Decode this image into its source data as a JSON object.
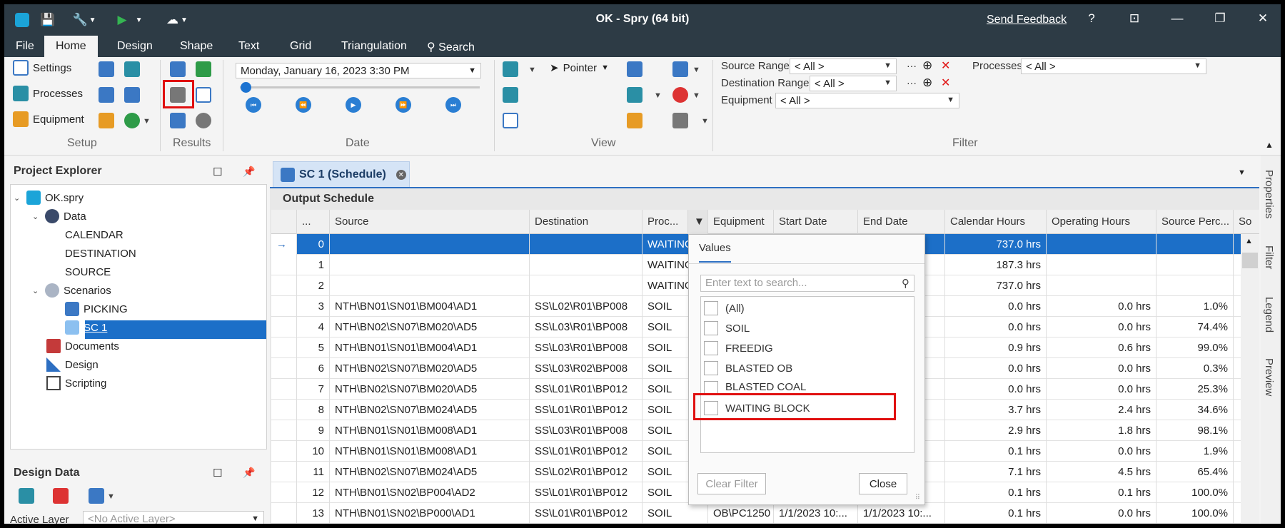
{
  "window": {
    "title": "OK - Spry (64 bit)",
    "send_feedback": "Send Feedback"
  },
  "menu": [
    "File",
    "Home",
    "Design",
    "Shape",
    "Text",
    "Grid",
    "Triangulation",
    "Search"
  ],
  "ribbon": {
    "setup": {
      "label": "Setup",
      "settings": "Settings",
      "processes": "Processes",
      "equipment": "Equipment"
    },
    "results": {
      "label": "Results"
    },
    "date": {
      "label": "Date",
      "datetime": "Monday, January 16, 2023 3:30 PM",
      "slider_position": 0.0
    },
    "view": {
      "label": "View",
      "pointer": "Pointer"
    },
    "filter": {
      "label": "Filter",
      "source_range_label": "Source Range",
      "source_range_value": "< All >",
      "destination_range_label": "Destination Range",
      "destination_range_value": "< All >",
      "equipment_label": "Equipment",
      "equipment_value": "< All >",
      "processes_label": "Processes",
      "processes_value": "< All >"
    }
  },
  "project_explorer": {
    "title": "Project Explorer",
    "root": "OK.spry",
    "data_label": "Data",
    "data_items": [
      "CALENDAR",
      "DESTINATION",
      "SOURCE"
    ],
    "scenarios_label": "Scenarios",
    "scenario_items": [
      "PICKING",
      "SC 1"
    ],
    "documents": "Documents",
    "design": "Design",
    "scripting": "Scripting"
  },
  "design_data": {
    "title": "Design Data",
    "active_layer_label": "Active Layer",
    "active_layer_value": "<No Active Layer>"
  },
  "doc_tab": {
    "label": "SC 1 (Schedule)"
  },
  "output_schedule": {
    "title": "Output Schedule",
    "columns": [
      "...",
      "Source",
      "Destination",
      "Proc...",
      "Equipment",
      "Start Date",
      "End Date",
      "Calendar Hours",
      "Operating Hours",
      "Source Perc...",
      "So"
    ],
    "rows": [
      {
        "idx": "0",
        "source": "",
        "dest": "",
        "proc": "WAITING",
        "equip": "",
        "start": "",
        "end": "",
        "cal": "737.0 hrs",
        "op": "",
        "pct": ""
      },
      {
        "idx": "1",
        "source": "",
        "dest": "",
        "proc": "WAITING",
        "equip": "",
        "start": "",
        "end": "",
        "cal": "187.3 hrs",
        "op": "",
        "pct": ""
      },
      {
        "idx": "2",
        "source": "",
        "dest": "",
        "proc": "WAITING",
        "equip": "",
        "start": "",
        "end": "",
        "cal": "737.0 hrs",
        "op": "",
        "pct": ""
      },
      {
        "idx": "3",
        "source": "NTH\\BN01\\SN01\\BM004\\AD1",
        "dest": "SS\\L02\\R01\\BP008",
        "proc": "SOIL",
        "equip": "",
        "start": "",
        "end": "",
        "cal": "0.0 hrs",
        "op": "0.0 hrs",
        "pct": "1.0%"
      },
      {
        "idx": "4",
        "source": "NTH\\BN02\\SN07\\BM020\\AD5",
        "dest": "SS\\L03\\R01\\BP008",
        "proc": "SOIL",
        "equip": "",
        "start": "",
        "end": "",
        "cal": "0.0 hrs",
        "op": "0.0 hrs",
        "pct": "74.4%"
      },
      {
        "idx": "5",
        "source": "NTH\\BN01\\SN01\\BM004\\AD1",
        "dest": "SS\\L03\\R01\\BP008",
        "proc": "SOIL",
        "equip": "",
        "start": "",
        "end": "",
        "cal": "0.9 hrs",
        "op": "0.6 hrs",
        "pct": "99.0%"
      },
      {
        "idx": "6",
        "source": "NTH\\BN02\\SN07\\BM020\\AD5",
        "dest": "SS\\L03\\R02\\BP008",
        "proc": "SOIL",
        "equip": "",
        "start": "",
        "end": "",
        "cal": "0.0 hrs",
        "op": "0.0 hrs",
        "pct": "0.3%"
      },
      {
        "idx": "7",
        "source": "NTH\\BN02\\SN07\\BM020\\AD5",
        "dest": "SS\\L01\\R01\\BP012",
        "proc": "SOIL",
        "equip": "",
        "start": "",
        "end": "",
        "cal": "0.0 hrs",
        "op": "0.0 hrs",
        "pct": "25.3%"
      },
      {
        "idx": "8",
        "source": "NTH\\BN02\\SN07\\BM024\\AD5",
        "dest": "SS\\L01\\R01\\BP012",
        "proc": "SOIL",
        "equip": "",
        "start": "",
        "end": "",
        "cal": "3.7 hrs",
        "op": "2.4 hrs",
        "pct": "34.6%"
      },
      {
        "idx": "9",
        "source": "NTH\\BN01\\SN01\\BM008\\AD1",
        "dest": "SS\\L03\\R01\\BP008",
        "proc": "SOIL",
        "equip": "",
        "start": "",
        "end": "",
        "cal": "2.9 hrs",
        "op": "1.8 hrs",
        "pct": "98.1%"
      },
      {
        "idx": "10",
        "source": "NTH\\BN01\\SN01\\BM008\\AD1",
        "dest": "SS\\L01\\R01\\BP012",
        "proc": "SOIL",
        "equip": "",
        "start": "",
        "end": "",
        "cal": "0.1 hrs",
        "op": "0.0 hrs",
        "pct": "1.9%"
      },
      {
        "idx": "11",
        "source": "NTH\\BN02\\SN07\\BM024\\AD5",
        "dest": "SS\\L02\\R01\\BP012",
        "proc": "SOIL",
        "equip": "",
        "start": "",
        "end": "",
        "cal": "7.1 hrs",
        "op": "4.5 hrs",
        "pct": "65.4%"
      },
      {
        "idx": "12",
        "source": "NTH\\BN01\\SN02\\BP004\\AD2",
        "dest": "SS\\L01\\R01\\BP012",
        "proc": "SOIL",
        "equip": "",
        "start": "",
        "end": "",
        "cal": "0.1 hrs",
        "op": "0.1 hrs",
        "pct": "100.0%"
      },
      {
        "idx": "13",
        "source": "NTH\\BN01\\SN02\\BP000\\AD1",
        "dest": "SS\\L01\\R01\\BP012",
        "proc": "SOIL",
        "equip": "OB\\PC1250",
        "start": "1/1/2023 10:...",
        "end": "1/1/2023 10:...",
        "cal": "0.1 hrs",
        "op": "0.0 hrs",
        "pct": "100.0%"
      }
    ]
  },
  "filter_popup": {
    "tab": "Values",
    "search_placeholder": "Enter text to search...",
    "options": [
      "(All)",
      "SOIL",
      "FREEDIG",
      "BLASTED OB",
      "BLASTED COAL",
      "WAITING BLOCK"
    ],
    "clear_filter": "Clear Filter",
    "close": "Close"
  },
  "right_rail": [
    "Properties",
    "Filter",
    "Legend",
    "Preview"
  ],
  "colors": {
    "titlebar": "#2d3b45",
    "selection": "#1c6fc8",
    "highlight": "#e01010"
  }
}
